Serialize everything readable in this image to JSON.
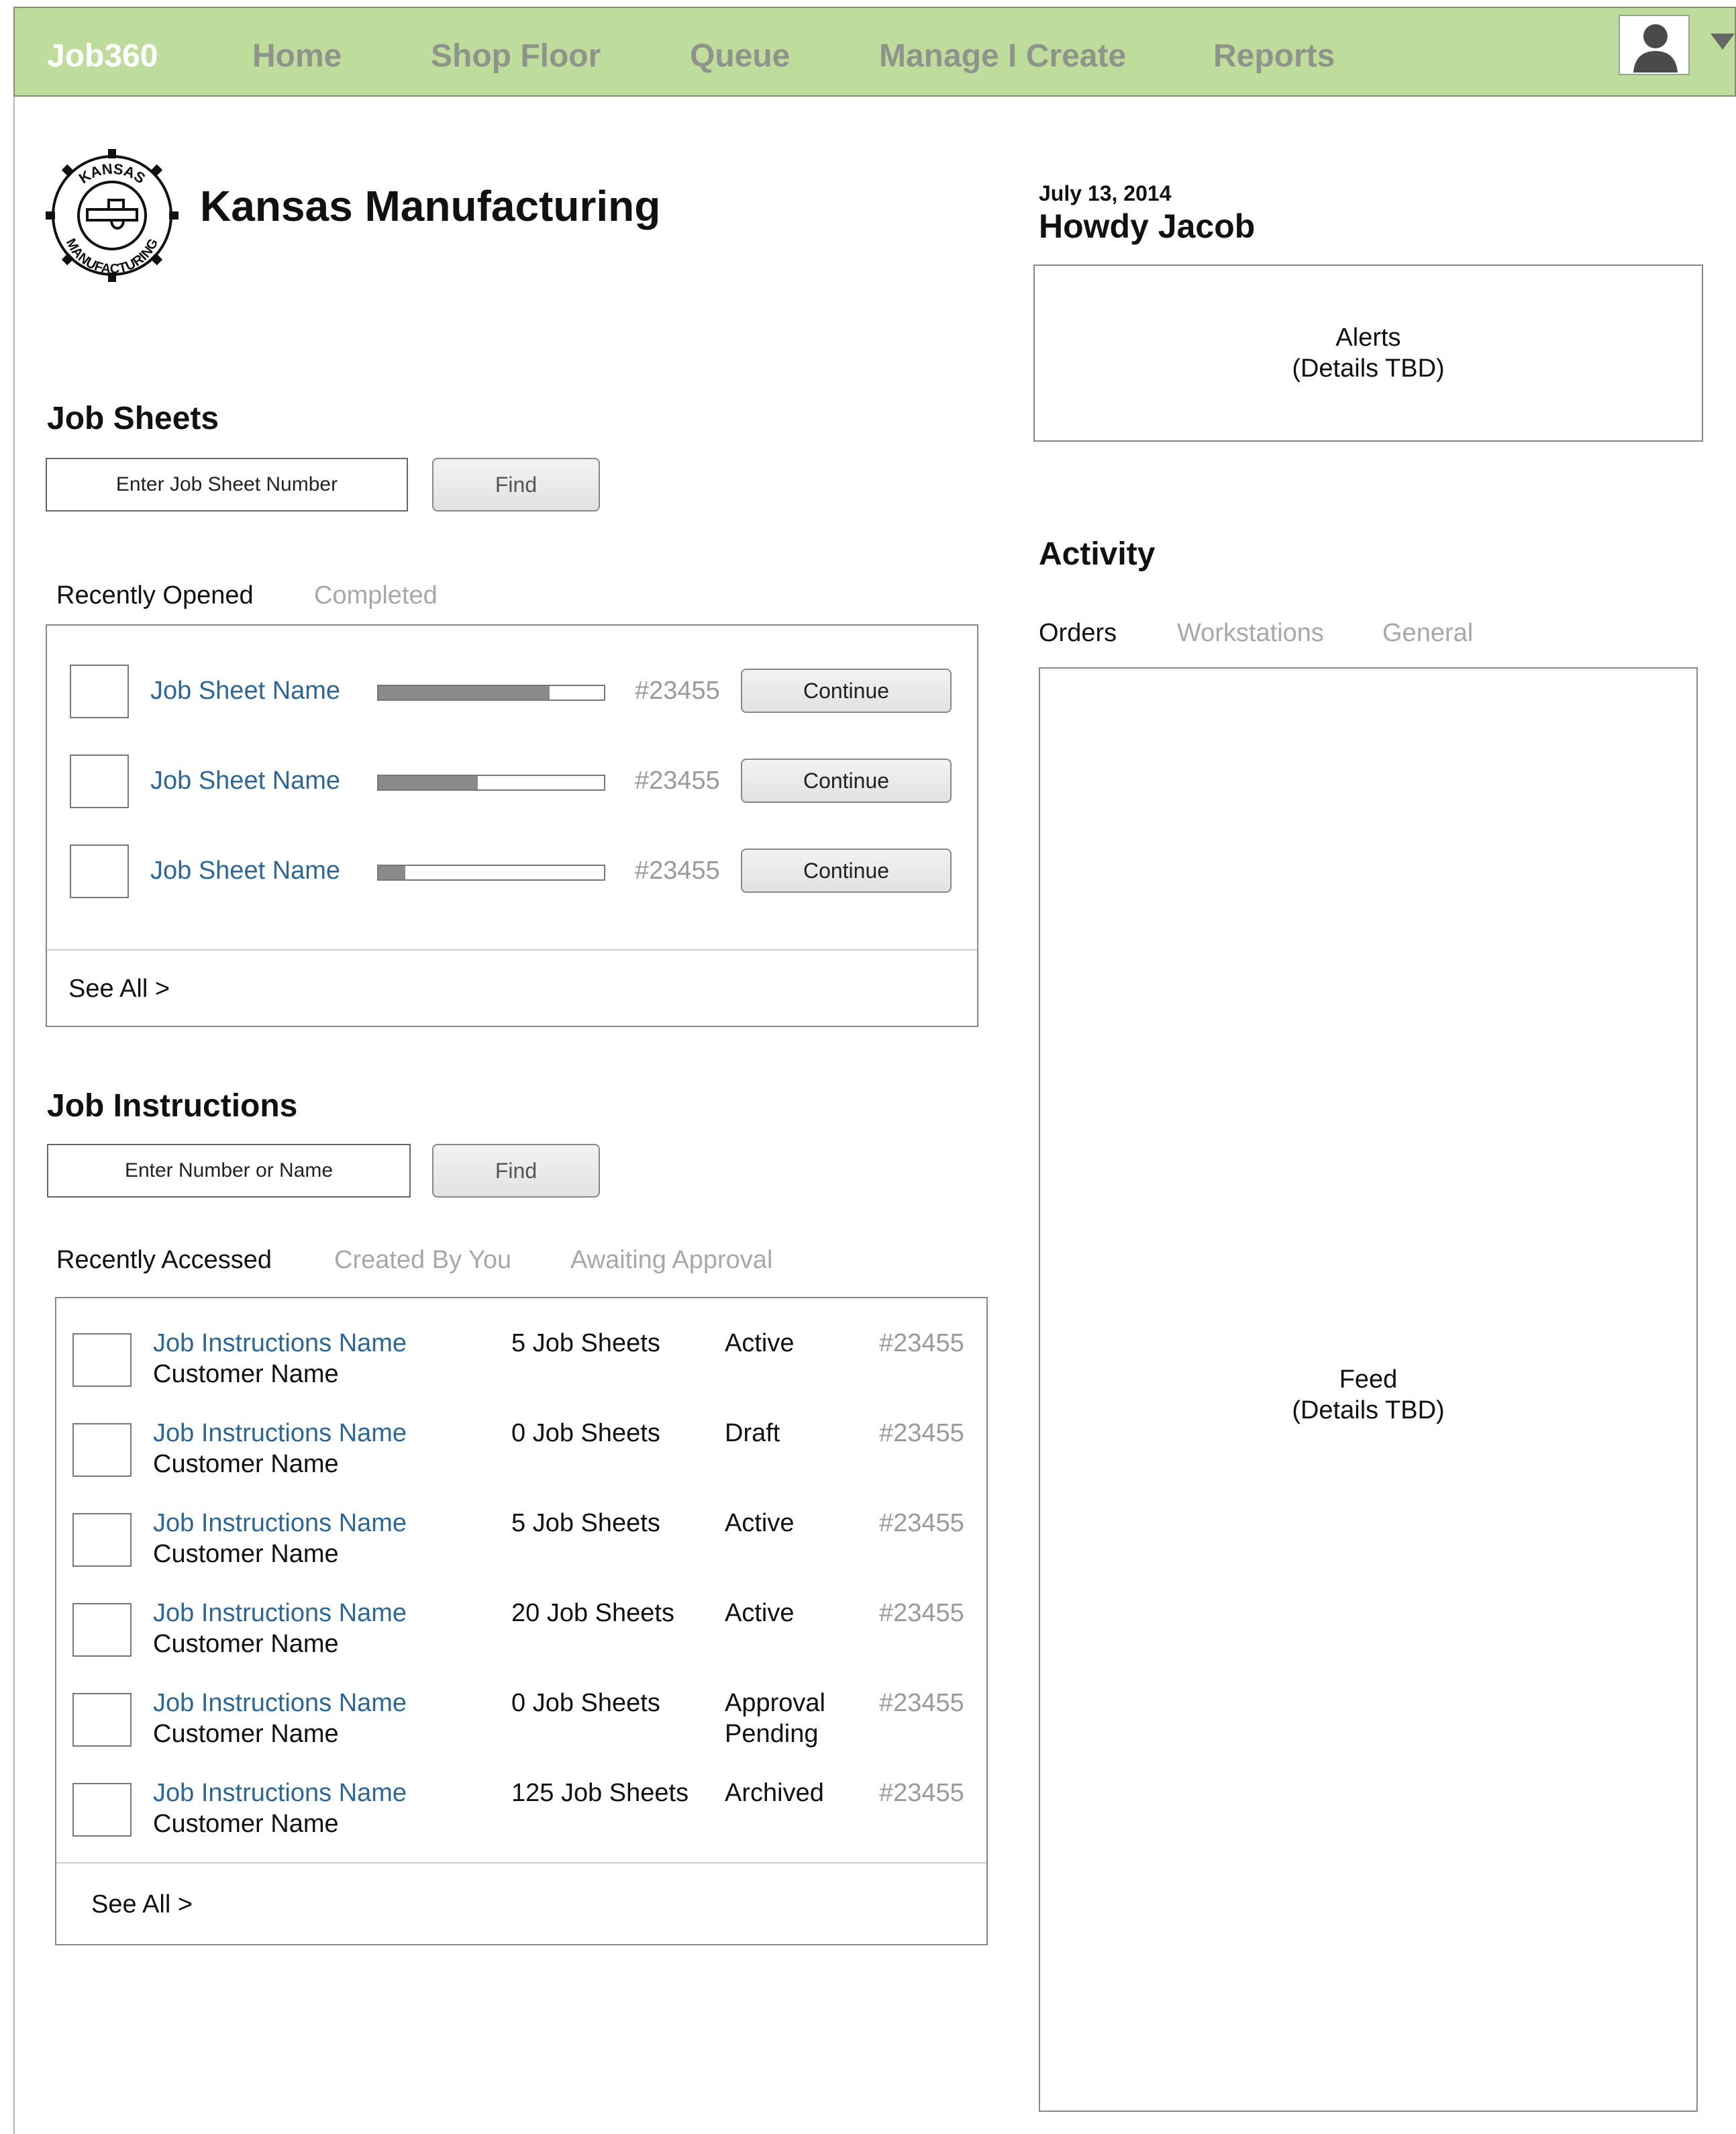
{
  "nav": {
    "brand": "Job360",
    "items": [
      "Home",
      "Shop Floor",
      "Queue",
      "Manage I Create",
      "Reports"
    ]
  },
  "icons": {
    "avatar": "user-silhouette-icon",
    "menu": "caret-down-icon",
    "logo": "gear-caliper-logo"
  },
  "company": {
    "name": "Kansas Manufacturing",
    "logo_text_top": "KANSAS",
    "logo_text_bottom": "MANUFACTURING"
  },
  "job_sheets": {
    "title": "Job Sheets",
    "search_placeholder": "Enter Job Sheet Number",
    "find_label": "Find",
    "tabs": [
      "Recently Opened",
      "Completed"
    ],
    "rows": [
      {
        "name": "Job Sheet Name",
        "progress": 0.76,
        "number": "#23455",
        "action": "Continue"
      },
      {
        "name": "Job Sheet Name",
        "progress": 0.44,
        "number": "#23455",
        "action": "Continue"
      },
      {
        "name": "Job Sheet Name",
        "progress": 0.12,
        "number": "#23455",
        "action": "Continue"
      }
    ],
    "see_all": "See All >"
  },
  "job_instructions": {
    "title": "Job Instructions",
    "search_placeholder": "Enter Number or Name",
    "find_label": "Find",
    "tabs": [
      "Recently Accessed",
      "Created By You",
      "Awaiting Approval"
    ],
    "rows": [
      {
        "name": "Job Instructions Name",
        "customer": "Customer Name",
        "sheets": "5 Job Sheets",
        "status": "Active",
        "number": "#23455"
      },
      {
        "name": "Job Instructions Name",
        "customer": "Customer Name",
        "sheets": "0 Job Sheets",
        "status": "Draft",
        "number": "#23455"
      },
      {
        "name": "Job Instructions Name",
        "customer": "Customer Name",
        "sheets": "5 Job Sheets",
        "status": "Active",
        "number": "#23455"
      },
      {
        "name": "Job Instructions Name",
        "customer": "Customer Name",
        "sheets": "20 Job Sheets",
        "status": "Active",
        "number": "#23455"
      },
      {
        "name": "Job Instructions Name",
        "customer": "Customer Name",
        "sheets": "0 Job Sheets",
        "status": "Approval",
        "status2": "Pending",
        "number": "#23455"
      },
      {
        "name": "Job Instructions Name",
        "customer": "Customer Name",
        "sheets": "125 Job Sheets",
        "status": "Archived",
        "number": "#23455"
      }
    ],
    "see_all": "See All >"
  },
  "header_right": {
    "date": "July 13, 2014",
    "greeting": "Howdy Jacob"
  },
  "alerts": {
    "line1": "Alerts",
    "line2": "(Details TBD)"
  },
  "activity": {
    "title": "Activity",
    "tabs": [
      "Orders",
      "Workstations",
      "General"
    ],
    "feed_line1": "Feed",
    "feed_line2": "(Details TBD)"
  }
}
